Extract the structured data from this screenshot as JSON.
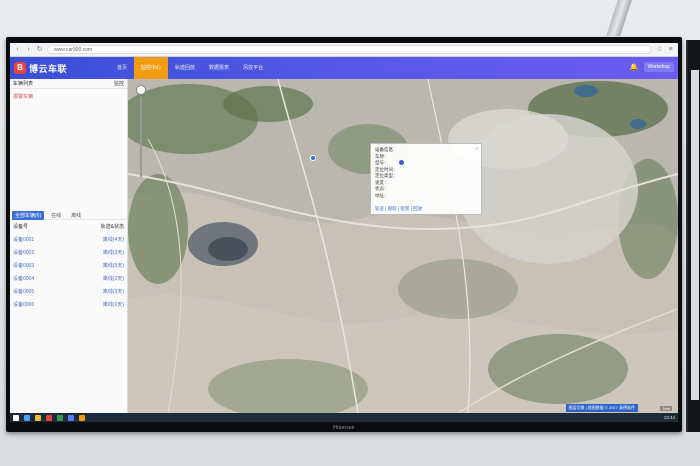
{
  "tv": {
    "brand": "Hisense"
  },
  "browser": {
    "url": "www.car900.com",
    "icons": [
      "back-icon",
      "forward-icon",
      "refresh-icon"
    ],
    "right_icons": [
      "star-icon",
      "menu-icon"
    ]
  },
  "app": {
    "logo_text": "博云车联",
    "menu": [
      {
        "label": "首页",
        "active": false
      },
      {
        "label": "监控中心",
        "active": true
      },
      {
        "label": "轨迹回放",
        "active": false
      },
      {
        "label": "数据报表",
        "active": false
      },
      {
        "label": "风控平台",
        "active": false
      }
    ],
    "user_label": "Workshop"
  },
  "sidebar": {
    "title": "车辆列表",
    "title_right": "监控",
    "alert_item": "报警车辆",
    "tabs": [
      "全部车辆(6)",
      "在线",
      "离线"
    ],
    "list_header": {
      "left": "设备号",
      "right": "轨迹&状态"
    },
    "rows": [
      {
        "id": "设备0001",
        "status": "离线(4天)"
      },
      {
        "id": "设备0002",
        "status": "离线(3天)"
      },
      {
        "id": "设备0003",
        "status": "离线(5天)"
      },
      {
        "id": "设备0004",
        "status": "离线(2天)"
      },
      {
        "id": "设备0005",
        "status": "离线(3天)"
      },
      {
        "id": "设备0006",
        "status": "离线(1天)"
      }
    ]
  },
  "popup": {
    "title": "设备信息",
    "lines": [
      "车牌：",
      "型号：",
      "定位时间：",
      "定位类型：",
      "速度：",
      "状态：",
      "地址："
    ],
    "actions": "轨迹 | 跟踪 | 街景 | 回放"
  },
  "map": {
    "footer_label": "图层切换  |  地图数据 © 2017 高德软件",
    "scale": "1km"
  },
  "taskbar": {
    "clock": "13:44",
    "icon_colors": [
      "#4aa3ff",
      "#f0c12e",
      "#e8453c",
      "#3c9a4f",
      "#5b7cff",
      "#f39c12"
    ]
  }
}
